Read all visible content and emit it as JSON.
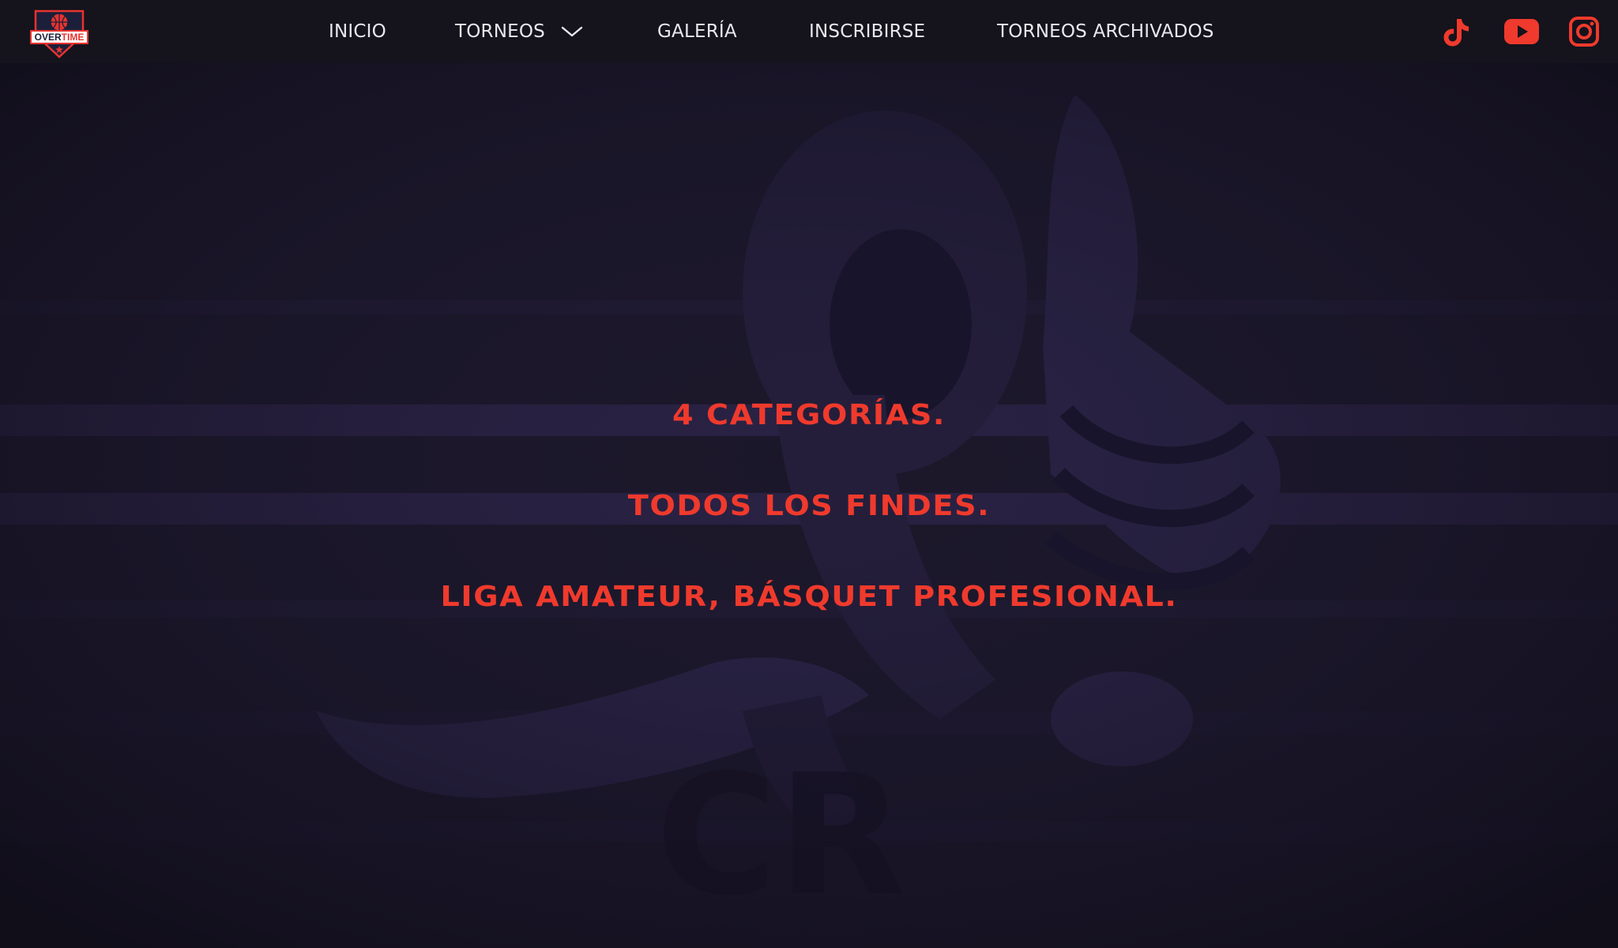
{
  "brand": {
    "logo_word_1": "OVER",
    "logo_word_2": "TIME",
    "colors": {
      "accent": "#ef3a2d",
      "navy": "#1c1f3a",
      "header_bg": "#15131c",
      "hero_bg": "#1a1628"
    }
  },
  "nav": {
    "items": [
      {
        "label": "INICIO"
      },
      {
        "label": "TORNEOS",
        "has_dropdown": true,
        "icon": "chevron-down-icon"
      },
      {
        "label": "GALERÍA"
      },
      {
        "label": "INSCRIBIRSE"
      },
      {
        "label": "TORNEOS ARCHIVADOS"
      }
    ]
  },
  "social": [
    {
      "name": "tiktok",
      "icon": "tiktok-icon"
    },
    {
      "name": "youtube",
      "icon": "youtube-icon"
    },
    {
      "name": "instagram",
      "icon": "instagram-icon"
    }
  ],
  "hero": {
    "lines": [
      "4 CATEGORÍAS.",
      "TODOS LOS FINDES.",
      "LIGA AMATEUR, BÁSQUET PROFESIONAL."
    ]
  }
}
